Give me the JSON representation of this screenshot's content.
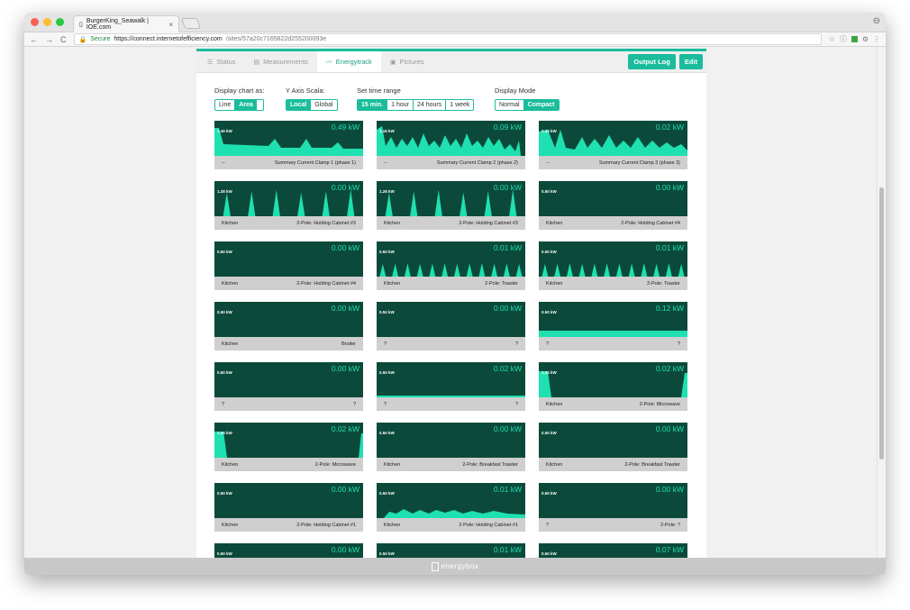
{
  "browser": {
    "tab_title": "BurgerKing_Seawalk | IOE.com",
    "tab_close": "×",
    "secure_label": "Secure",
    "url_host": "https://connect.internetofefficiency.com",
    "url_path": "/sites/57a20c7165822d255200093e",
    "back_icon": "←",
    "forward_icon": "→",
    "reload_icon": "C",
    "star_icon": "☆",
    "profile_icon": "⊖"
  },
  "page_tabs": [
    {
      "label": "Status",
      "icon": "☰"
    },
    {
      "label": "Measurements",
      "icon": "▤"
    },
    {
      "label": "Energytrack",
      "icon": "〰"
    },
    {
      "label": "Pictures",
      "icon": "▣"
    }
  ],
  "header_buttons": {
    "output_log": "Output Log",
    "edit": "Edit"
  },
  "controls": {
    "display_chart": {
      "label": "Display chart as:",
      "options": [
        "Line",
        "Area"
      ],
      "selected": "Area"
    },
    "y_axis": {
      "label": "Y Axis Scala:",
      "options": [
        "Local",
        "Global"
      ],
      "selected": "Local"
    },
    "time_range": {
      "label": "Set time range",
      "options": [
        "15 min.",
        "1 hour",
        "24 hours",
        "1 week"
      ],
      "selected": "15 min."
    },
    "display_mode": {
      "label": "Display Mode",
      "options": [
        "Normal",
        "Compact"
      ],
      "selected": "Compact"
    }
  },
  "colors": {
    "accent": "#1abc9c",
    "chart_bg": "#0b4a3a",
    "fill": "#1ee0b0"
  },
  "cards": [
    {
      "kw": "0.49 kW",
      "ymax": "3.45 kW",
      "left": "--",
      "right": "Summary Current Clamp 1 (phase 1)",
      "pattern": "c1"
    },
    {
      "kw": "0.09 kW",
      "ymax": "4.15 kW",
      "left": "--",
      "right": "Summary Current Clamp 2 (phase 2)",
      "pattern": "c2"
    },
    {
      "kw": "0.02 kW",
      "ymax": "2.34 kW",
      "left": "--",
      "right": "Summary Current Clamp 3 (phase 3)",
      "pattern": "c3"
    },
    {
      "kw": "0.00 kW",
      "ymax": "1.28 kW",
      "left": "Kitchen",
      "right": "2-Pole: Holding Cabinet #3",
      "pattern": "hold"
    },
    {
      "kw": "0.00 kW",
      "ymax": "1.28 kW",
      "left": "Kitchen",
      "right": "2-Pole: Holding Cabinet #3",
      "pattern": "hold"
    },
    {
      "kw": "0.00 kW",
      "ymax": "0.50 kW",
      "left": "Kitchen",
      "right": "2-Pole: Holding Cabinet #4",
      "pattern": "flat"
    },
    {
      "kw": "0.00 kW",
      "ymax": "0.50 kW",
      "left": "Kitchen",
      "right": "2-Pole: Holding Cabinet #4",
      "pattern": "flat"
    },
    {
      "kw": "0.01 kW",
      "ymax": "0.50 kW",
      "left": "Kitchen",
      "right": "2-Pole: Toaster",
      "pattern": "toaster"
    },
    {
      "kw": "0.01 kW",
      "ymax": "0.50 kW",
      "left": "Kitchen",
      "right": "2-Pole: Toaster",
      "pattern": "toaster"
    },
    {
      "kw": "0.00 kW",
      "ymax": "0.50 kW",
      "left": "Kitchen",
      "right": "Broiler",
      "pattern": "flat"
    },
    {
      "kw": "0.00 kW",
      "ymax": "0.50 kW",
      "left": "?",
      "right": "?",
      "pattern": "flat"
    },
    {
      "kw": "0.12 kW",
      "ymax": "0.50 kW",
      "left": "?",
      "right": "?",
      "pattern": "band"
    },
    {
      "kw": "0.00 kW",
      "ymax": "0.50 kW",
      "left": "?",
      "right": "?",
      "pattern": "flat"
    },
    {
      "kw": "0.02 kW",
      "ymax": "0.50 kW",
      "left": "?",
      "right": "?",
      "pattern": "thin"
    },
    {
      "kw": "0.02 kW",
      "ymax": "1.34 kW",
      "left": "Kitchen",
      "right": "2-Pole: Microwave",
      "pattern": "micro"
    },
    {
      "kw": "0.02 kW",
      "ymax": "1.34 kW",
      "left": "Kitchen",
      "right": "2-Pole: Microwave",
      "pattern": "micro2"
    },
    {
      "kw": "0.00 kW",
      "ymax": "0.50 kW",
      "left": "Kitchen",
      "right": "2-Pole: Breakfast Toaster",
      "pattern": "flat"
    },
    {
      "kw": "0.00 kW",
      "ymax": "0.50 kW",
      "left": "Kitchen",
      "right": "2-Pole: Breakfast Toaster",
      "pattern": "flat"
    },
    {
      "kw": "0.00 kW",
      "ymax": "0.50 kW",
      "left": "Kitchen",
      "right": "2-Pole: Holding Cabinet #1",
      "pattern": "flat"
    },
    {
      "kw": "0.01 kW",
      "ymax": "0.50 kW",
      "left": "Kitchen",
      "right": "2-Pole: Holding Cabinet #1",
      "pattern": "steps"
    },
    {
      "kw": "0.00 kW",
      "ymax": "0.50 kW",
      "left": "?",
      "right": "2-Pole: ?",
      "pattern": "flat"
    },
    {
      "kw": "0.00 kW",
      "ymax": "0.50 kW",
      "left": "",
      "right": "",
      "pattern": "flat"
    },
    {
      "kw": "0.01 kW",
      "ymax": "0.50 kW",
      "left": "",
      "right": "",
      "pattern": "flat"
    },
    {
      "kw": "0.07 kW",
      "ymax": "0.50 kW",
      "left": "",
      "right": "",
      "pattern": "flat"
    }
  ],
  "footer_brand": "energybox"
}
